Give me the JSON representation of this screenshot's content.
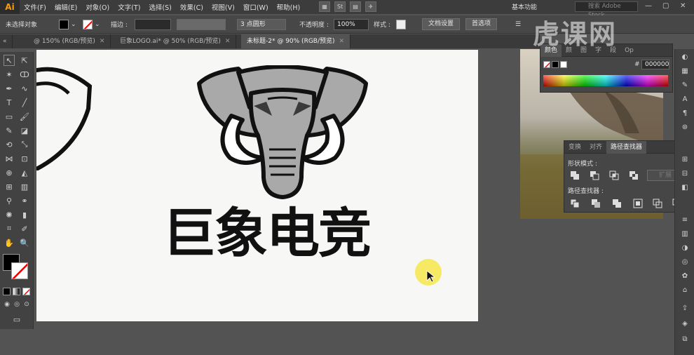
{
  "app": {
    "logo": "Ai"
  },
  "menu": [
    "文件(F)",
    "编辑(E)",
    "对象(O)",
    "文字(T)",
    "选择(S)",
    "效果(C)",
    "视图(V)",
    "窗口(W)",
    "帮助(H)"
  ],
  "workspace": {
    "label": "基本功能",
    "search_placeholder": "搜索 Adobe Stock"
  },
  "control": {
    "no_selection": "未选择对象",
    "stroke_label": "描边 :",
    "brush_value": "3 点圆形",
    "opacity_label": "不透明度 :",
    "opacity_value": "100%",
    "style_label": "样式 :",
    "doc_setup": "文档设置",
    "prefs": "首选项"
  },
  "tabs": [
    {
      "label": "@ 150% (RGB/预览)"
    },
    {
      "label": "巨象LOGO.ai* @ 50% (RGB/预览)"
    },
    {
      "label": "未标题-2* @ 90% (RGB/预览)"
    }
  ],
  "artboard": {
    "logo_text": "巨象电竞"
  },
  "color_panel": {
    "tabs": [
      "颜色",
      "颜",
      "图",
      "字",
      "段",
      "Op"
    ],
    "hex_symbol": "#",
    "hex": "000000"
  },
  "pathfinder": {
    "tabs": [
      "变换",
      "对齐",
      "路径查找器"
    ],
    "shape_modes_label": "形状模式 :",
    "pathfinders_label": "路径查找器 :",
    "expand_label": "扩展"
  },
  "watermark": "虎课网",
  "colors": {
    "fill": "#000000",
    "elephant": "#a9a9a9",
    "ai_orange": "#ff9a00",
    "highlight": "#f6e84a"
  }
}
